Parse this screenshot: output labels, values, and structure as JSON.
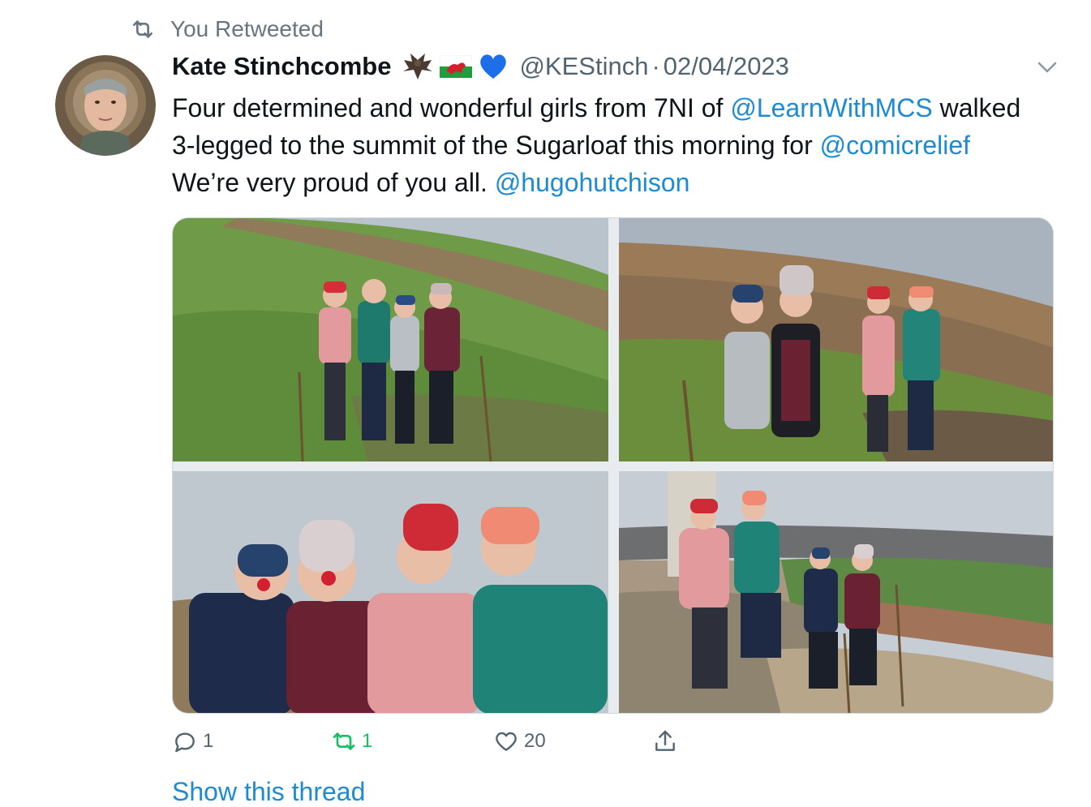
{
  "retweet_context": {
    "label": "You Retweeted",
    "icon": "retweet-icon"
  },
  "tweet": {
    "author": {
      "display_name": "Kate Stinchcombe",
      "emojis": [
        "bat-emoji",
        "wales-flag-emoji",
        "blue-heart-emoji"
      ],
      "handle": "@KEStinch",
      "separator": "·",
      "date": "02/04/2023"
    },
    "text": {
      "part1": "Four determined and wonderful girls from 7NI of ",
      "mention1": "@LearnWithMCS",
      "part2": " walked 3-legged to the summit of the Sugarloaf this morning for ",
      "mention2": "@comicrelief",
      "part3": " We’re very proud of you all. ",
      "mention3": "@hugohutchison"
    },
    "actions": {
      "reply_count": "1",
      "retweet_count": "1",
      "like_count": "20"
    },
    "show_thread": "Show this thread"
  },
  "colors": {
    "link": "#1d8bd2",
    "secondary_text": "#536471",
    "retweet_active": "#17bf63"
  }
}
